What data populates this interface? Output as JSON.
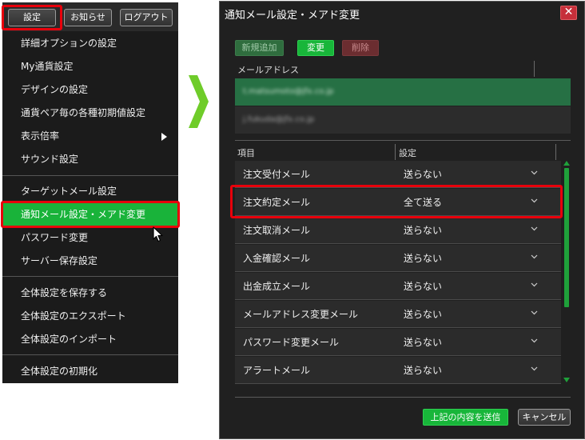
{
  "menu": {
    "top_buttons": [
      "設定",
      "お知らせ",
      "ログアウト"
    ],
    "items": [
      "詳細オプションの設定",
      "My通貨設定",
      "デザインの設定",
      "通貨ペア毎の各種初期値設定",
      "表示倍率",
      "サウンド設定",
      "ターゲットメール設定",
      "通知メール設定・メアド変更",
      "パスワード変更",
      "サーバー保存設定",
      "全体設定を保存する",
      "全体設定のエクスポート",
      "全体設定のインポート",
      "全体設定の初期化"
    ],
    "active_item": "通知メール設定・メアド変更"
  },
  "dialog": {
    "title": "通知メール設定・メアド変更",
    "close_label": "✕",
    "buttons": {
      "add": "新規追加",
      "change": "変更",
      "delete": "削除",
      "submit": "上記の内容を送信",
      "cancel": "キャンセル"
    },
    "email_header": "メールアドレス",
    "emails": [
      "t.matsumoto@jfx.co.jp",
      "j.fukuda@jfx.co.jp"
    ],
    "settings_headers": {
      "item": "項目",
      "setting": "設定"
    },
    "settings": [
      {
        "label": "注文受付メール",
        "value": "送らない"
      },
      {
        "label": "注文約定メール",
        "value": "全て送る"
      },
      {
        "label": "注文取消メール",
        "value": "送らない"
      },
      {
        "label": "入金確認メール",
        "value": "送らない"
      },
      {
        "label": "出金成立メール",
        "value": "送らない"
      },
      {
        "label": "メールアドレス変更メール",
        "value": "送らない"
      },
      {
        "label": "パスワード変更メール",
        "value": "送らない"
      },
      {
        "label": "アラートメール",
        "value": "送らない"
      }
    ]
  },
  "colors": {
    "accent_green": "#19b33a",
    "highlight_red": "#e8000b",
    "panel_bg": "#1b1b1b"
  },
  "icons": [
    "arrow-right-icon",
    "mouse-cursor-icon",
    "chevron-down-icon",
    "close-icon",
    "submenu-arrow-icon"
  ]
}
